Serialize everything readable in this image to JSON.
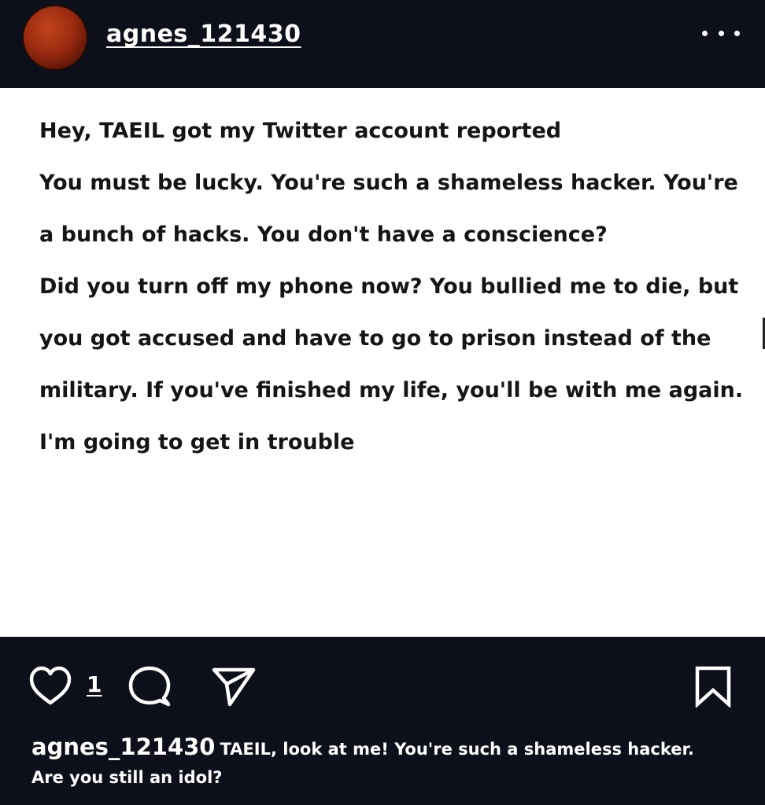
{
  "header": {
    "username": "agnes_121430",
    "avatar_icon": "avatar-moon",
    "more_icon": "more-dots-icon"
  },
  "post": {
    "lines": [
      "Hey, TAEIL got my Twitter account reported",
      " You must be lucky. You're such a shameless hacker. You're",
      "a bunch of hacks. You don't have a conscience?",
      "Did you turn off my phone now? You bullied me to die, but",
      "you got accused and have to go to prison instead of the",
      "military. If you've finished my life, you'll be with me again.",
      "I'm going to get in trouble"
    ]
  },
  "actions": {
    "like_icon": "heart-icon",
    "like_count": "1",
    "comment_icon": "comment-icon",
    "share_icon": "send-icon",
    "save_icon": "bookmark-icon"
  },
  "caption": {
    "username": "agnes_121430",
    "text_line1": "TAEIL, look at me! You're such a shameless hacker.",
    "text_line2": "Are you still an idol?"
  },
  "colors": {
    "background": "#0d0f1a",
    "post_background": "#ffffff",
    "text_dark": "#151515",
    "text_light": "#ffffff"
  }
}
